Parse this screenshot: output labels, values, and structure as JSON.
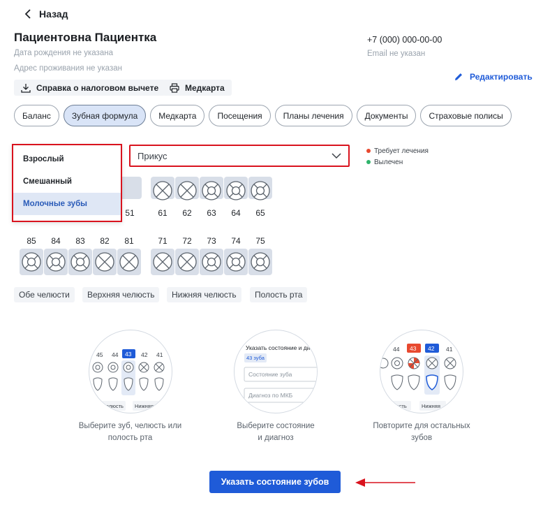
{
  "header": {
    "back_label": "Назад",
    "patient_name": "Пациентовна Пациентка",
    "dob": "Дата рождения не указана",
    "address": "Адрес проживания не указан",
    "phone": "+7 (000) 000-00-00",
    "email": "Email не указан",
    "tax_button": "Справка о налоговом вычете",
    "medcard_button": "Медкарта",
    "edit_label": "Редактировать"
  },
  "tabs": [
    {
      "label": "Баланс"
    },
    {
      "label": "Зубная формула"
    },
    {
      "label": "Медкарта"
    },
    {
      "label": "Посещения"
    },
    {
      "label": "Планы лечения"
    },
    {
      "label": "Документы"
    },
    {
      "label": "Страховые полисы"
    }
  ],
  "active_tab": "Зубная формула",
  "bite": {
    "selected": "Прикус",
    "options": [
      "Взрослый",
      "Смешанный",
      "Молочные зубы"
    ],
    "highlighted": "Молочные зубы"
  },
  "legend": [
    {
      "label": "Требует лечения",
      "color": "#e8492f"
    },
    {
      "label": "Вылечен",
      "color": "#2fb36b"
    }
  ],
  "teeth": {
    "upper_right_visible": [
      "51"
    ],
    "upper_left": [
      "61",
      "62",
      "63",
      "64",
      "65"
    ],
    "lower_right": [
      "85",
      "84",
      "83",
      "82",
      "81"
    ],
    "lower_left": [
      "71",
      "72",
      "73",
      "74",
      "75"
    ]
  },
  "jaw_chips": [
    "Обе челюсти",
    "Верхняя челюсть",
    "Нижняя челюсть",
    "Полость рта"
  ],
  "steps": [
    {
      "caption_1": "Выберите зуб, челюсть или",
      "caption_2": "полость рта",
      "numbers": [
        "45",
        "44",
        "43",
        "42",
        "41"
      ],
      "chip_1": "челюсть",
      "chip_2": "Нижняя"
    },
    {
      "caption_1": "Выберите состояние",
      "caption_2": "и диагноз",
      "title": "Указать состояние и ди",
      "tag": "43 зуба",
      "field_1": "Состояние зуба",
      "field_2": "Диагноз по МКБ"
    },
    {
      "caption_1": "Повторите для остальных",
      "caption_2": "зубов",
      "numbers": [
        "44",
        "43",
        "42",
        "41"
      ],
      "chip_1": "олость",
      "chip_2": "Нижняя"
    }
  ],
  "cta_label": "Указать состояние зубов",
  "colors": {
    "accent": "#1f5bd8",
    "highlight_red": "#d9131e",
    "tooth_bg": "#d8dee8"
  }
}
